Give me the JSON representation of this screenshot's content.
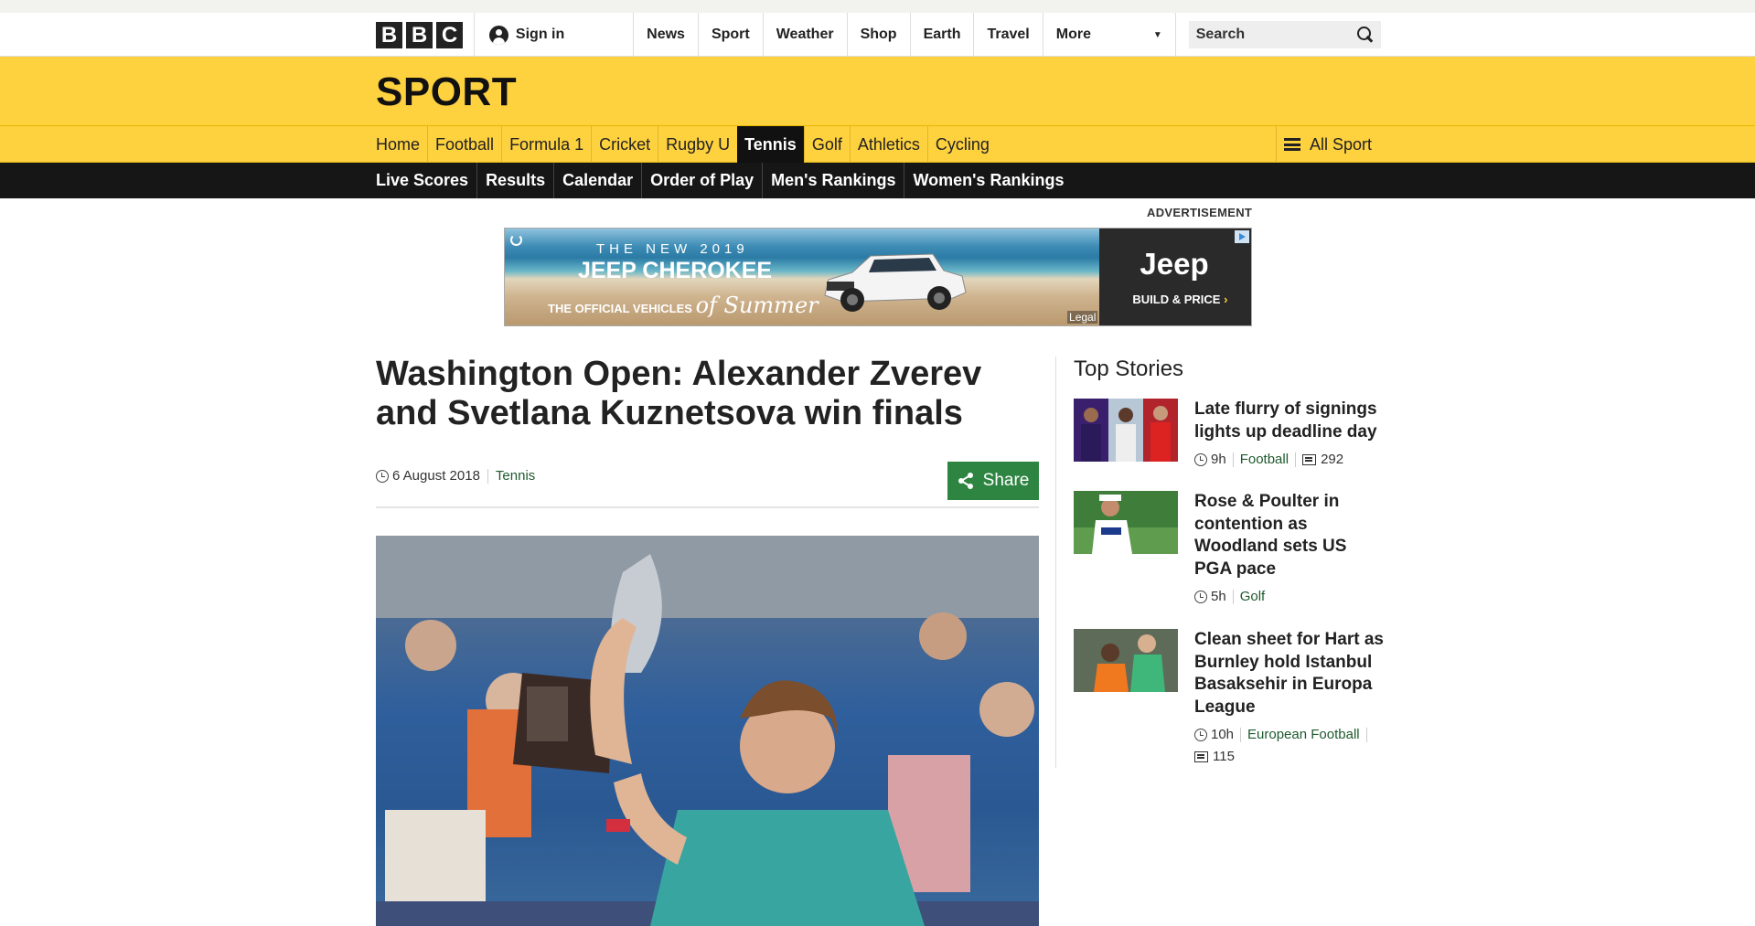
{
  "bbc": {
    "logo": [
      "B",
      "B",
      "C"
    ],
    "signin": "Sign in",
    "nav": [
      "News",
      "Sport",
      "Weather",
      "Shop",
      "Earth",
      "Travel"
    ],
    "more": "More",
    "search_placeholder": "Search"
  },
  "sport": {
    "title": "SPORT",
    "nav": [
      "Home",
      "Football",
      "Formula 1",
      "Cricket",
      "Rugby U",
      "Tennis",
      "Golf",
      "Athletics",
      "Cycling"
    ],
    "active": "Tennis",
    "all_sport": "All Sport",
    "subnav": [
      "Live Scores",
      "Results",
      "Calendar",
      "Order of Play",
      "Men's Rankings",
      "Women's Rankings"
    ]
  },
  "ad": {
    "label": "ADVERTISEMENT",
    "line1": "THE NEW 2019",
    "line2": "JEEP CHEROKEE",
    "line3": "THE OFFICIAL VEHICLES",
    "line3_script": "of Summer",
    "legal": "Legal",
    "brand": "Jeep",
    "cta": "BUILD & PRICE",
    "cta_arrow": "›"
  },
  "article": {
    "headline": "Washington Open: Alexander Zverev and Svetlana Kuznetsova win finals",
    "date": "6 August 2018",
    "tag": "Tennis",
    "share": "Share"
  },
  "top_stories": {
    "title": "Top Stories",
    "items": [
      {
        "headline": "Late flurry of signings lights up deadline day",
        "time": "9h",
        "tag": "Football",
        "comments": "292"
      },
      {
        "headline": "Rose & Poulter in contention as Woodland sets US PGA pace",
        "time": "5h",
        "tag": "Golf"
      },
      {
        "headline": "Clean sheet for Hart as Burnley hold Istanbul Basaksehir in Europa League",
        "time": "10h",
        "tag": "European Football",
        "comments": "115"
      }
    ]
  },
  "colors": {
    "sport_yellow": "#fed13f",
    "nav_black": "#161616",
    "share_green": "#2e8541",
    "tag_green": "#1e5a2e"
  }
}
